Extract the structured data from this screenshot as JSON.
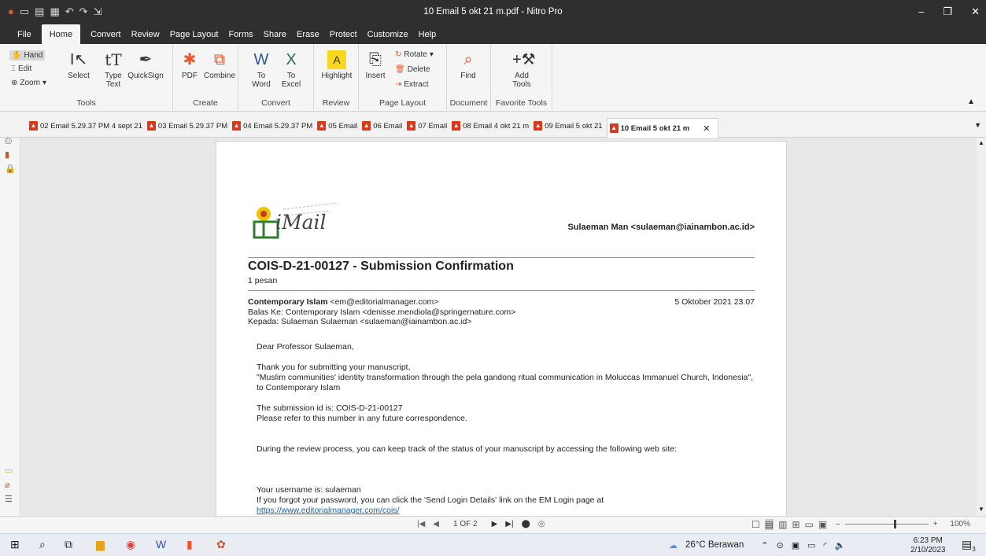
{
  "window": {
    "title": "10 Email 5 okt 21 m.pdf - Nitro Pro"
  },
  "menus": [
    "File",
    "Home",
    "Convert",
    "Review",
    "Page Layout",
    "Forms",
    "Share",
    "Erase",
    "Protect",
    "Customize",
    "Help"
  ],
  "ribbon": {
    "tools": {
      "hand": "Hand",
      "edit": "Edit",
      "zoom": "Zoom",
      "select": "Select",
      "type_text": "Type Text",
      "quicksign": "QuickSign",
      "label": "Tools"
    },
    "create": {
      "pdf": "PDF",
      "combine": "Combine",
      "label": "Create"
    },
    "convert": {
      "to_word": "To Word",
      "to_excel": "To Excel",
      "label": "Convert"
    },
    "review": {
      "highlight": "Highlight",
      "label": "Review"
    },
    "page_layout": {
      "insert": "Insert",
      "rotate": "Rotate",
      "delete": "Delete",
      "extract": "Extract",
      "label": "Page Layout"
    },
    "document": {
      "find": "Find",
      "label": "Document"
    },
    "favorite": {
      "add_tools": "Add Tools",
      "label": "Favorite Tools"
    }
  },
  "tabs": [
    "02 Email 5.29.37 PM 4 sept 21",
    "03 Email 5.29.37 PM",
    "04 Email 5.29.37 PM",
    "05 Email",
    "06 Email",
    "07 Email",
    "08 Email 4 okt 21 m",
    "09 Email 5 okt 21",
    "10 Email 5 okt 21 m"
  ],
  "email": {
    "logo_text": "iMail",
    "sender_header": "Sulaeman Man <sulaeman@iainambon.ac.id>",
    "subject": "COIS-D-21-00127 - Submission Confirmation",
    "count": "1 pesan",
    "from_name": "Contemporary Islam",
    "from_addr": "<em@editorialmanager.com>",
    "reply_to": "Balas Ke: Contemporary Islam <denisse.mendiola@springernature.com>",
    "to": "Kepada: Sulaeman Sulaeman <sulaeman@iainambon.ac.id>",
    "date": "5 Oktober 2021 23.07",
    "greeting": "Dear Professor Sulaeman,",
    "p1": "Thank you for submitting your manuscript,",
    "p1b": "\"Muslim communities' identity transformation through the pela gandong ritual communication in Moluccas Immanuel Church, Indonesia\", to Contemporary Islam",
    "p2": "The submission id is: COIS-D-21-00127",
    "p2b": "Please refer to this number in any future correspondence.",
    "p3": "During the review process, you can keep track of the status of your manuscript by accessing the following web site:",
    "p4": "Your username is: sulaeman",
    "p4b": "If you forgot your password, you can click the 'Send Login Details' link on the EM Login page at",
    "link": "https://www.editorialmanager.com/cois/"
  },
  "status": {
    "page": "1 OF 2",
    "zoom": "100%"
  },
  "taskbar": {
    "weather": "26°C Berawan",
    "time": "6:23 PM",
    "date": "2/10/2023",
    "notif": "3"
  }
}
